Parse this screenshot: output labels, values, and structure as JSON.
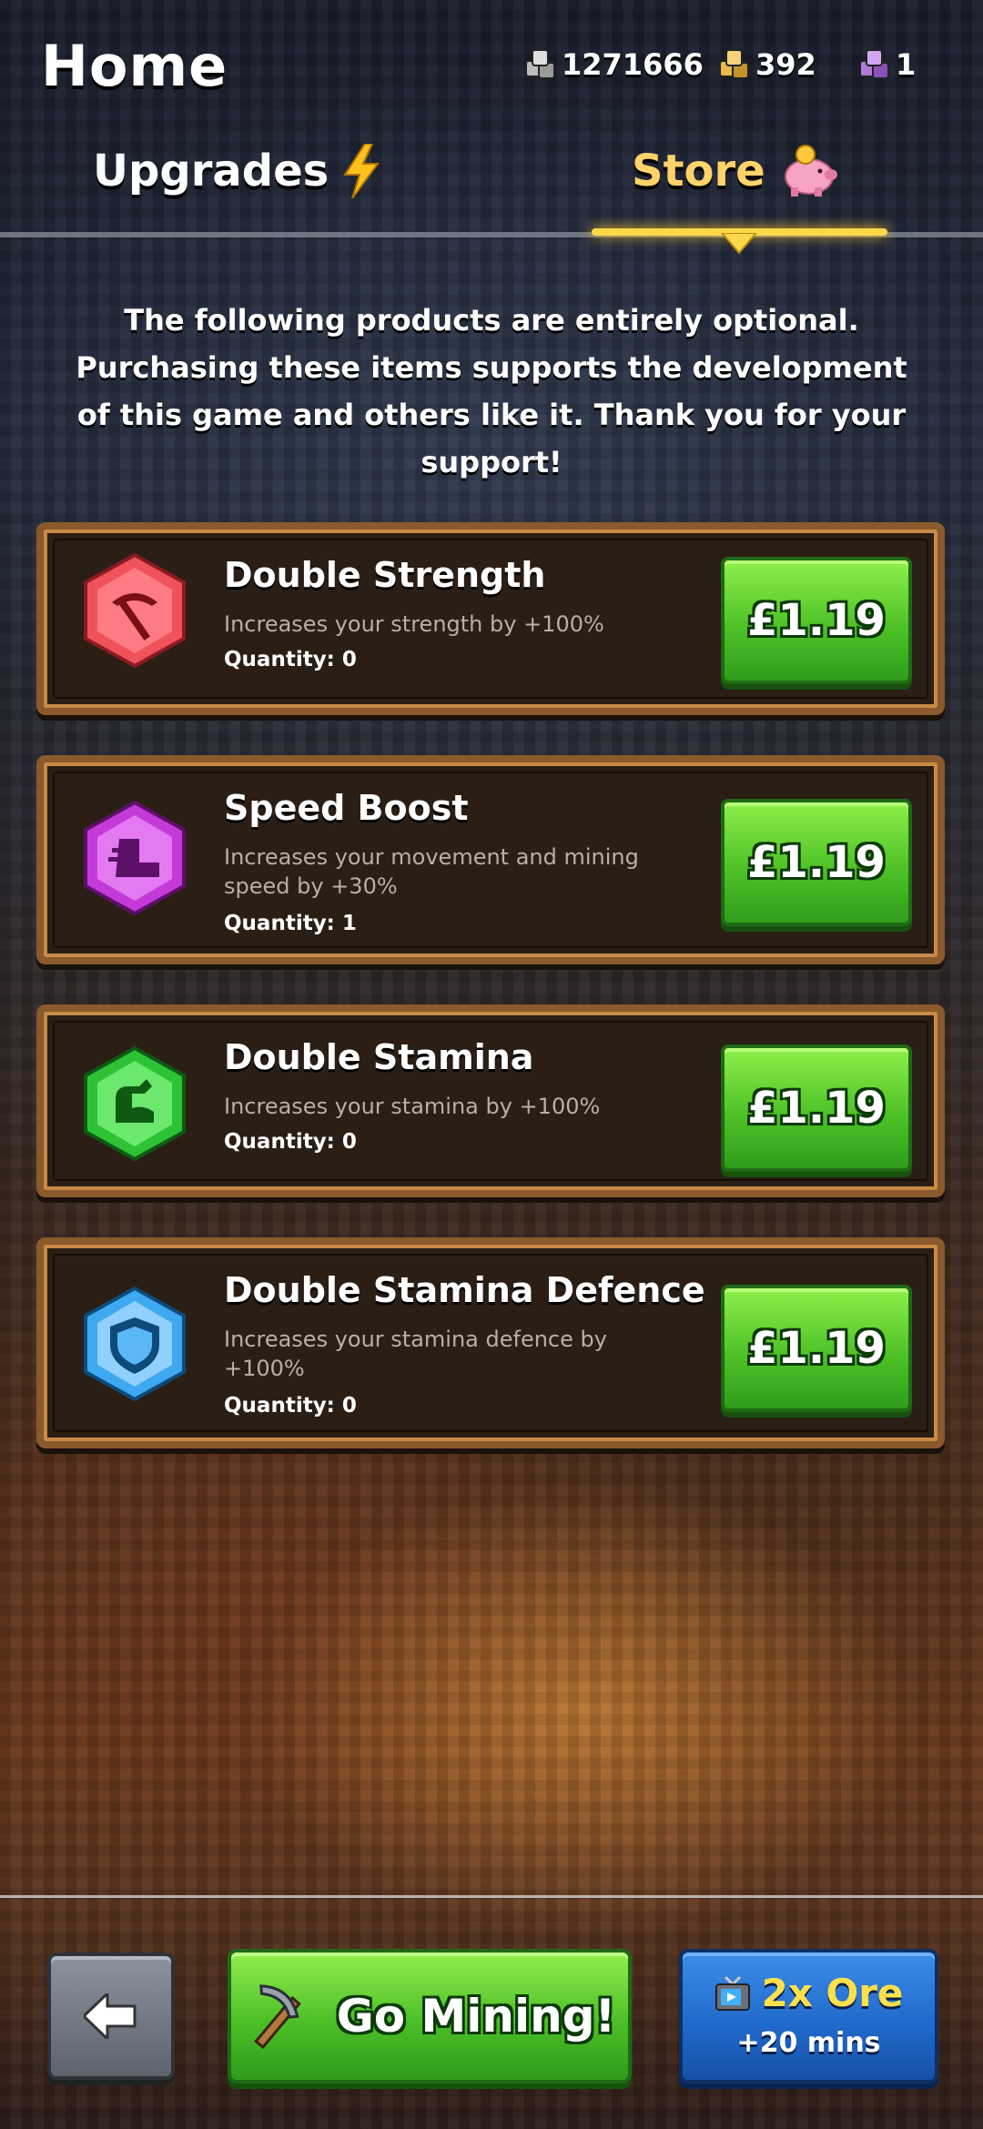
{
  "header": {
    "title": "Home",
    "currencies": [
      {
        "name": "silver-ore",
        "value": "1271666",
        "color": "#c7c7c7"
      },
      {
        "name": "gold-ore",
        "value": "392",
        "color": "#e8b84a"
      },
      {
        "name": "purple-ore",
        "value": "1",
        "color": "#b07ad8"
      }
    ]
  },
  "tabs": [
    {
      "label": "Upgrades",
      "icon": "lightning-icon",
      "active": false
    },
    {
      "label": "Store",
      "icon": "piggy-bank-icon",
      "active": true
    }
  ],
  "notice": "The following products are entirely optional. Purchasing these items supports the development of this game and others like it. Thank you for your support!",
  "products": [
    {
      "name": "Double Strength",
      "description": "Increases your strength by +100%",
      "quantity": "Quantity: 0",
      "price": "£1.19",
      "icon": "pickaxe-gem-icon",
      "color": "#e8444e"
    },
    {
      "name": "Speed Boost",
      "description": "Increases your movement and mining speed by +30%",
      "quantity": "Quantity: 1",
      "price": "£1.19",
      "icon": "boot-gem-icon",
      "color": "#c43ad8"
    },
    {
      "name": "Double Stamina",
      "description": "Increases your stamina by +100%",
      "quantity": "Quantity: 0",
      "price": "£1.19",
      "icon": "arm-gem-icon",
      "color": "#34c83c"
    },
    {
      "name": "Double Stamina Defence",
      "description": "Increases your stamina defence by +100%",
      "quantity": "Quantity: 0",
      "price": "£1.19",
      "icon": "shield-gem-icon",
      "color": "#3ea8f0"
    }
  ],
  "bottom": {
    "back_icon": "arrow-left-icon",
    "go_label": "Go Mining!",
    "ore_title": "2x Ore",
    "ore_sub": "+20 mins"
  }
}
